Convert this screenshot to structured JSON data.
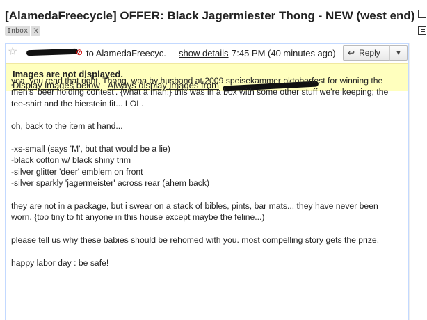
{
  "subject": "[AlamedaFreecycle] OFFER: Black Jagermiester Thong - NEW (west end)",
  "labels": [
    {
      "text": "Inbox",
      "remove": "X"
    }
  ],
  "message": {
    "to_text": "to AlamedaFreecyc.",
    "show_details": "show details",
    "time": "7:45 PM (40 minutes ago)",
    "reply_label": "Reply",
    "reply_icon": "reply-arrow-icon",
    "more_icon": "chevron-down-icon",
    "star_icon": "star-icon"
  },
  "images_warning": {
    "title": "Images are not displayed.",
    "link_display_below": "Display images below",
    "separator": " - ",
    "link_always_display": "Always display images from"
  },
  "body": {
    "p1": "yea, you read that right. Thong. won by husband at 2009 speisekammer oktoberfest for winning the men's 'beer holding contest'. {what a man!} this was in a box with some other stuff we're keeping; the tee-shirt and the bierstein fit... LOL.",
    "p2": "oh, back to the item at hand...",
    "list": [
      "-xs-small (says 'M', but that would be a lie)",
      "-black cotton w/ black shiny trim",
      "-silver glitter 'deer' emblem on front",
      "-silver sparkly 'jagermeister' across rear (ahem back)"
    ],
    "p3": "they are not in a package, but i swear on a stack of bibles, pints, bar mats... they have never been worn. {too tiny to fit anyone in this house except maybe the feline...)",
    "p4": "please tell us why these babies should be rehomed with you. most compelling story gets the prize.",
    "p5": "happy labor day : be safe!"
  },
  "colors": {
    "warning_bg": "#ffffbe",
    "card_border": "#c3d9ff",
    "redaction": "#111111"
  }
}
